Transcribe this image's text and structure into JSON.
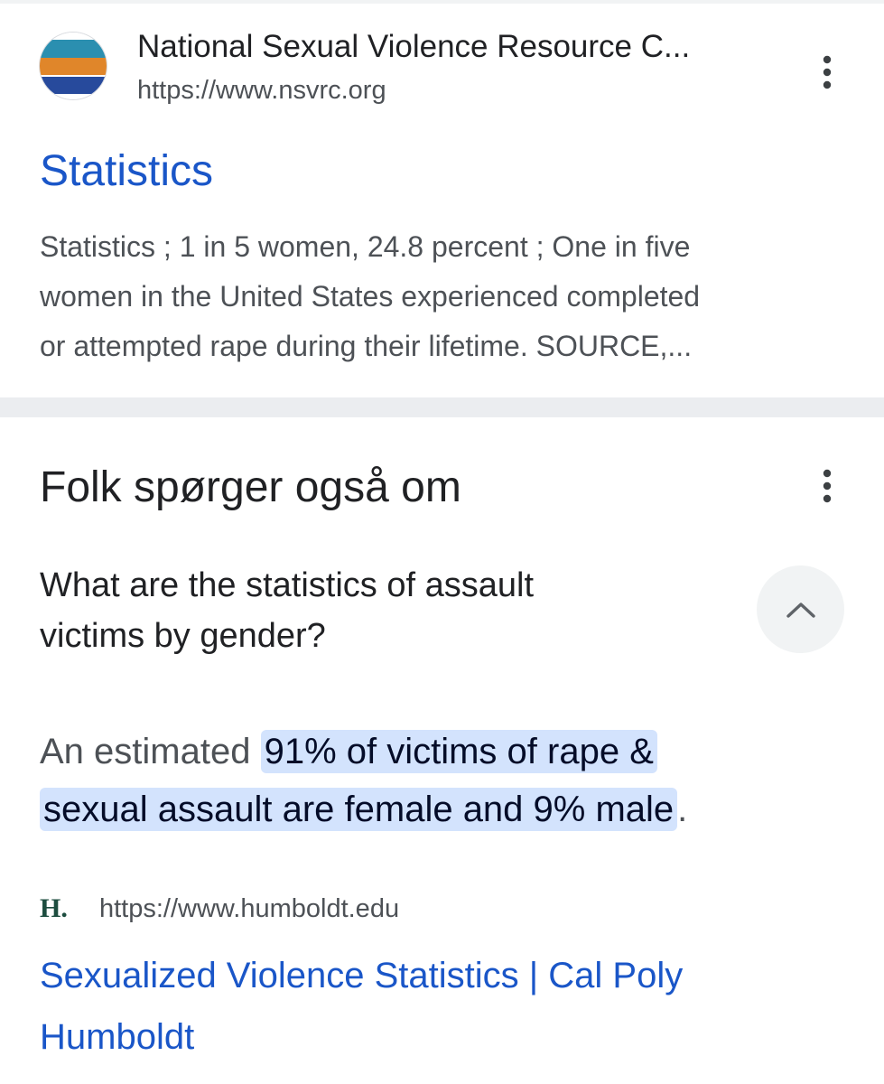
{
  "result": {
    "site_name": "National Sexual Violence Resource C...",
    "site_url": "https://www.nsvrc.org",
    "title": "Statistics",
    "snippet_lines": [
      "Statistics ; 1 in 5 women, 24.8 percent ; One in five",
      "women in the United States experienced completed",
      "or attempted rape during their lifetime. SOURCE,..."
    ],
    "favicon_colors": [
      "#2b8fb0",
      "#e0862a",
      "#274a9c"
    ]
  },
  "people_also_ask": {
    "heading": "Folk spørger også om",
    "question_lines": [
      "What are the statistics of assault",
      "victims by gender?"
    ],
    "answer": {
      "prefix": "An estimated ",
      "highlight_line1": "91% of victims of rape &",
      "highlight_line2": "sexual assault are female and 9% male",
      "suffix": "."
    },
    "source": {
      "logo_text": "H.",
      "url": "https://www.humboldt.edu",
      "title_lines": [
        "Sexualized Violence Statistics | Cal Poly",
        "Humboldt"
      ]
    }
  },
  "icons": {
    "more_options": "vertical-dots-icon",
    "collapse": "chevron-up-icon"
  },
  "colors": {
    "link": "#1a56c8",
    "highlight": "#d3e3fd",
    "divider": "#ebedf0"
  }
}
